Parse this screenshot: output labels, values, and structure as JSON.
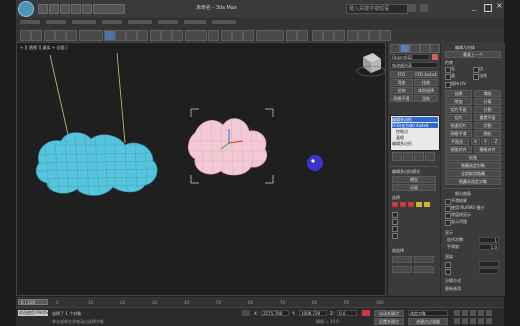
{
  "window": {
    "title": "未命名 - 3ds Max",
    "search_placeholder": "键入关键字或短语"
  },
  "viewport": {
    "label": "+ ][ 透视 ][ 真实 + 边面 ]"
  },
  "command_panel": {
    "object_name": "Object002",
    "modifier_list": "修改器列表",
    "buttons": [
      "FFD 3x3x3",
      "FFD 4x4x4",
      "弯曲",
      "扭曲",
      "拉伸",
      "体积选择",
      "网格平滑",
      "涅软"
    ],
    "stack": [
      "编辑多边形",
      "FFD(长方体) 4x4x4",
      "控制点",
      "晶格",
      "编辑多边形"
    ],
    "section_edit_poly_mode": "编辑多边形模式",
    "radio_model": "模型",
    "radio_animate": "动画",
    "section_selection": "选择",
    "soft_selection": "软选择"
  },
  "side_panel": {
    "title": "编辑几何体",
    "repeat_last": "重复上一个",
    "constraint": "约束",
    "options": [
      "无",
      "边",
      "面",
      "法线"
    ],
    "preserve_uv": "保持 UV",
    "buttons": [
      "创建",
      "塌陷",
      "附加",
      "分离",
      "切片平面",
      "分割",
      "切片",
      "重置平面",
      "快速切片",
      "切割",
      "网格平滑",
      "细化",
      "平面化",
      "X",
      "Y",
      "Z",
      "视图对齐",
      "栅格对齐",
      "松弛",
      "隐藏选定对象",
      "全部取消隐藏",
      "隐藏未选定对象"
    ],
    "section_subdivision": "细分曲面",
    "smooth_result": "平滑结果",
    "use_nurms": "使用 NURMS 细分",
    "isoline": "等值线显示",
    "show_cage": "显示代理",
    "display_label": "显示",
    "iterations_label": "迭代次数:",
    "iterations_value": "1",
    "smoothness_label": "平滑度:",
    "smoothness_value": "1.0",
    "render_label": "渲染",
    "separate_by": "分隔方式",
    "update_options": "更新选项"
  },
  "timeline": {
    "frame": "0 / 100",
    "ticks": [
      "0",
      "10",
      "20",
      "30",
      "40",
      "50",
      "60",
      "70",
      "80",
      "90",
      "100"
    ]
  },
  "status": {
    "selection": "选择了 1 个对象",
    "prompt": "单击或单击并拖动以选择对象",
    "welcome": "欢迎使用 MAXScript",
    "x_label": "X:",
    "x_value": "2575.708",
    "y_label": "Y:",
    "y_value": "1008.729",
    "z_label": "Z:",
    "z_value": "0.0",
    "grid": "栅格 = 10.0",
    "auto_key": "自动关键点",
    "set_key": "设置关键点",
    "selected": "选定对象",
    "key_filter": "关键点过滤器"
  },
  "colors": {
    "cloud_blue": "#56c4dc",
    "pink_object": "#f4c9d6",
    "cursor": "#3a35c7",
    "selection": "#5a7fb8"
  }
}
